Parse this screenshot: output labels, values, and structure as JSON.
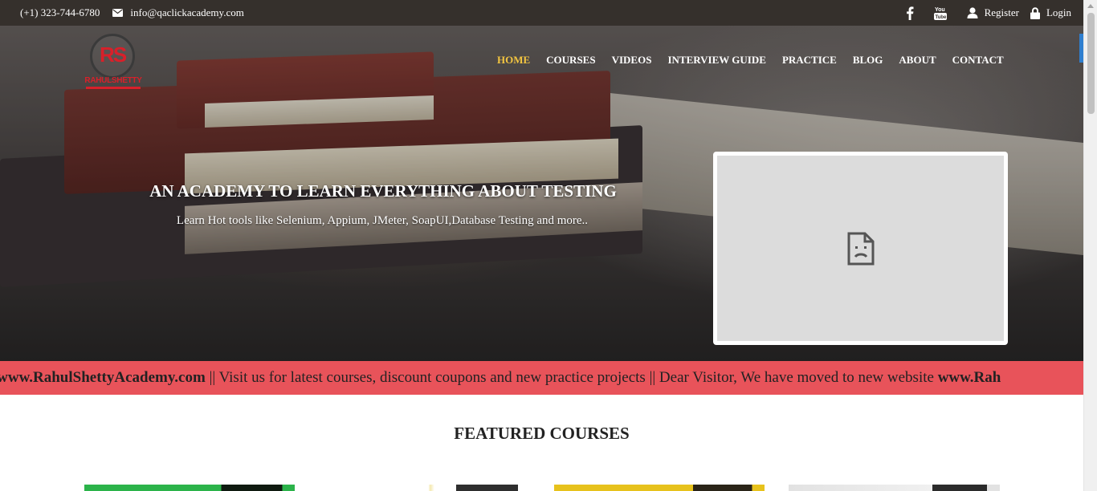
{
  "topbar": {
    "phone": "(+1) 323-744-6780",
    "email": "info@qaclickacademy.com",
    "register_label": "Register",
    "login_label": "Login",
    "icons": [
      "facebook-icon",
      "youtube-icon",
      "user-icon",
      "lock-icon",
      "envelope-icon"
    ]
  },
  "logo": {
    "monogram": "RS",
    "name": "RAHULSHETTY"
  },
  "nav": {
    "items": [
      "HOME",
      "COURSES",
      "VIDEOS",
      "INTERVIEW GUIDE",
      "PRACTICE",
      "BLOG",
      "ABOUT",
      "CONTACT"
    ],
    "active": "HOME",
    "active_color": "#f3c540"
  },
  "hero": {
    "title": "AN ACADEMY TO LEARN EVERYTHING ABOUT TESTING",
    "subtitle": "Learn Hot tools like Selenium, Appium, JMeter, SoapUI,Database Testing and more.."
  },
  "video": {
    "icon": "broken-document-icon"
  },
  "ticker": {
    "part1": "site ",
    "site1": "www.RahulShettyAcademy.com",
    "part2": " || Visit us for latest courses, discount coupons and new practice projects || Dear Visitor, We have moved to new website ",
    "site2": "www.Rah",
    "background": "#e8535a"
  },
  "featured": {
    "heading": "FEATURED COURSES"
  },
  "colors": {
    "topbar": "#35302c",
    "accent": "#f3c540",
    "brand_red": "#d8202a"
  }
}
